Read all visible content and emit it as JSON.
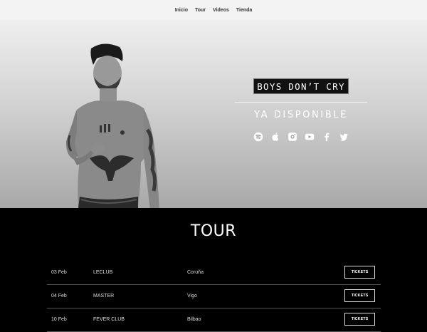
{
  "nav": {
    "items": [
      {
        "label": "Inicio"
      },
      {
        "label": "Tour"
      },
      {
        "label": "Videos"
      },
      {
        "label": "Tienda"
      }
    ]
  },
  "hero": {
    "album_title": "BOYS DON’T CRY",
    "availability": "YA DISPONIBLE",
    "social_icons": [
      "spotify-icon",
      "apple-icon",
      "instagram-icon",
      "youtube-icon",
      "facebook-icon",
      "twitter-icon"
    ]
  },
  "tour": {
    "title": "TOUR",
    "dates": [
      {
        "date": "03 Feb",
        "venue": "LECLUB",
        "city": "Coruña",
        "ticket_label": "TICKETS"
      },
      {
        "date": "04 Feb",
        "venue": "MASTER",
        "city": "Vigo",
        "ticket_label": "TICKETS"
      },
      {
        "date": "10 Feb",
        "venue": "FEVER CLUB",
        "city": "Bilbao",
        "ticket_label": "TICKETS"
      }
    ]
  }
}
